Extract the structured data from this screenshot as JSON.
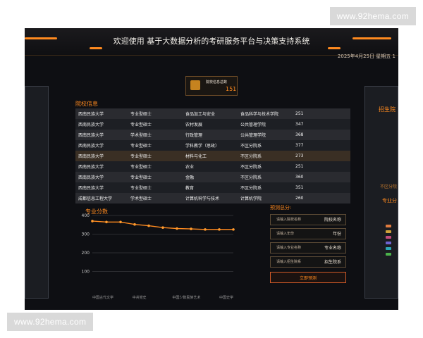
{
  "watermarks": {
    "top": "www.92hema.com",
    "bottom": "www.92hema.com"
  },
  "header": {
    "title": "欢迎使用 基于大数据分析的考研服务平台与决策支持系统",
    "datetime": "2025年4月25日 星期五 1"
  },
  "stat_box": {
    "label": "院校信息总数",
    "value": "151"
  },
  "sections": {
    "school_info": "院校信息",
    "major_scores": "专业分数",
    "prediction": "预测总分:"
  },
  "table": {
    "rows": [
      [
        "西南民族大学",
        "专业型硕士",
        "食品加工与安全",
        "食品科学与技术学院",
        "251"
      ],
      [
        "西南民族大学",
        "专业型硕士",
        "农村发展",
        "公共管理学院",
        "347"
      ],
      [
        "西南民族大学",
        "学术型硕士",
        "行政管理",
        "公共管理学院",
        "368"
      ],
      [
        "西南民族大学",
        "专业型硕士",
        "学科教学（思政）",
        "不区分院系",
        "377"
      ],
      [
        "西南民族大学",
        "专业型硕士",
        "材料与化工",
        "不区分院系",
        "273"
      ],
      [
        "西南民族大学",
        "专业型硕士",
        "农业",
        "不区分院系",
        "251"
      ],
      [
        "西南民族大学",
        "专业型硕士",
        "金融",
        "不区分院系",
        "360"
      ],
      [
        "西南民族大学",
        "专业型硕士",
        "教育",
        "不区分院系",
        "351"
      ],
      [
        "成都信息工程大学",
        "学术型硕士",
        "计算机科学与技术",
        "计算机学院",
        "260"
      ]
    ]
  },
  "chart_data": {
    "type": "line",
    "x": [
      "中国古代文学",
      "中共党史",
      "中国少数民族艺术",
      "中国史学"
    ],
    "y": [
      370,
      365,
      365,
      352,
      345,
      335,
      330,
      328,
      325,
      325,
      325
    ],
    "ylim": [
      0,
      400
    ],
    "yticks": [
      100,
      200,
      300,
      400
    ],
    "grid": true,
    "colors": {
      "line": "#ff8a1f",
      "points": "#ff9a2d",
      "axis": "#6b6b6b"
    }
  },
  "prediction_form": {
    "fields": [
      {
        "placeholder": "请输入院校名称",
        "label": "院校名称"
      },
      {
        "placeholder": "请输入年份",
        "label": "年份"
      },
      {
        "placeholder": "请输入专业名称",
        "label": "专业名称"
      },
      {
        "placeholder": "请输入招生院系",
        "label": "招生院系"
      }
    ],
    "button": "立即预测"
  },
  "right_panel": {
    "title": "招生院",
    "label_small": "不区分院",
    "label_big": "专业分",
    "legend_colors": [
      "#e07b3f",
      "#d0a23a",
      "#c24b7c",
      "#6f63d1",
      "#2ca7b6",
      "#4bb34b"
    ]
  },
  "colors": {
    "accent": "#ff8a1f",
    "bg": "#0e0f13",
    "panel": "#1b1d22"
  }
}
